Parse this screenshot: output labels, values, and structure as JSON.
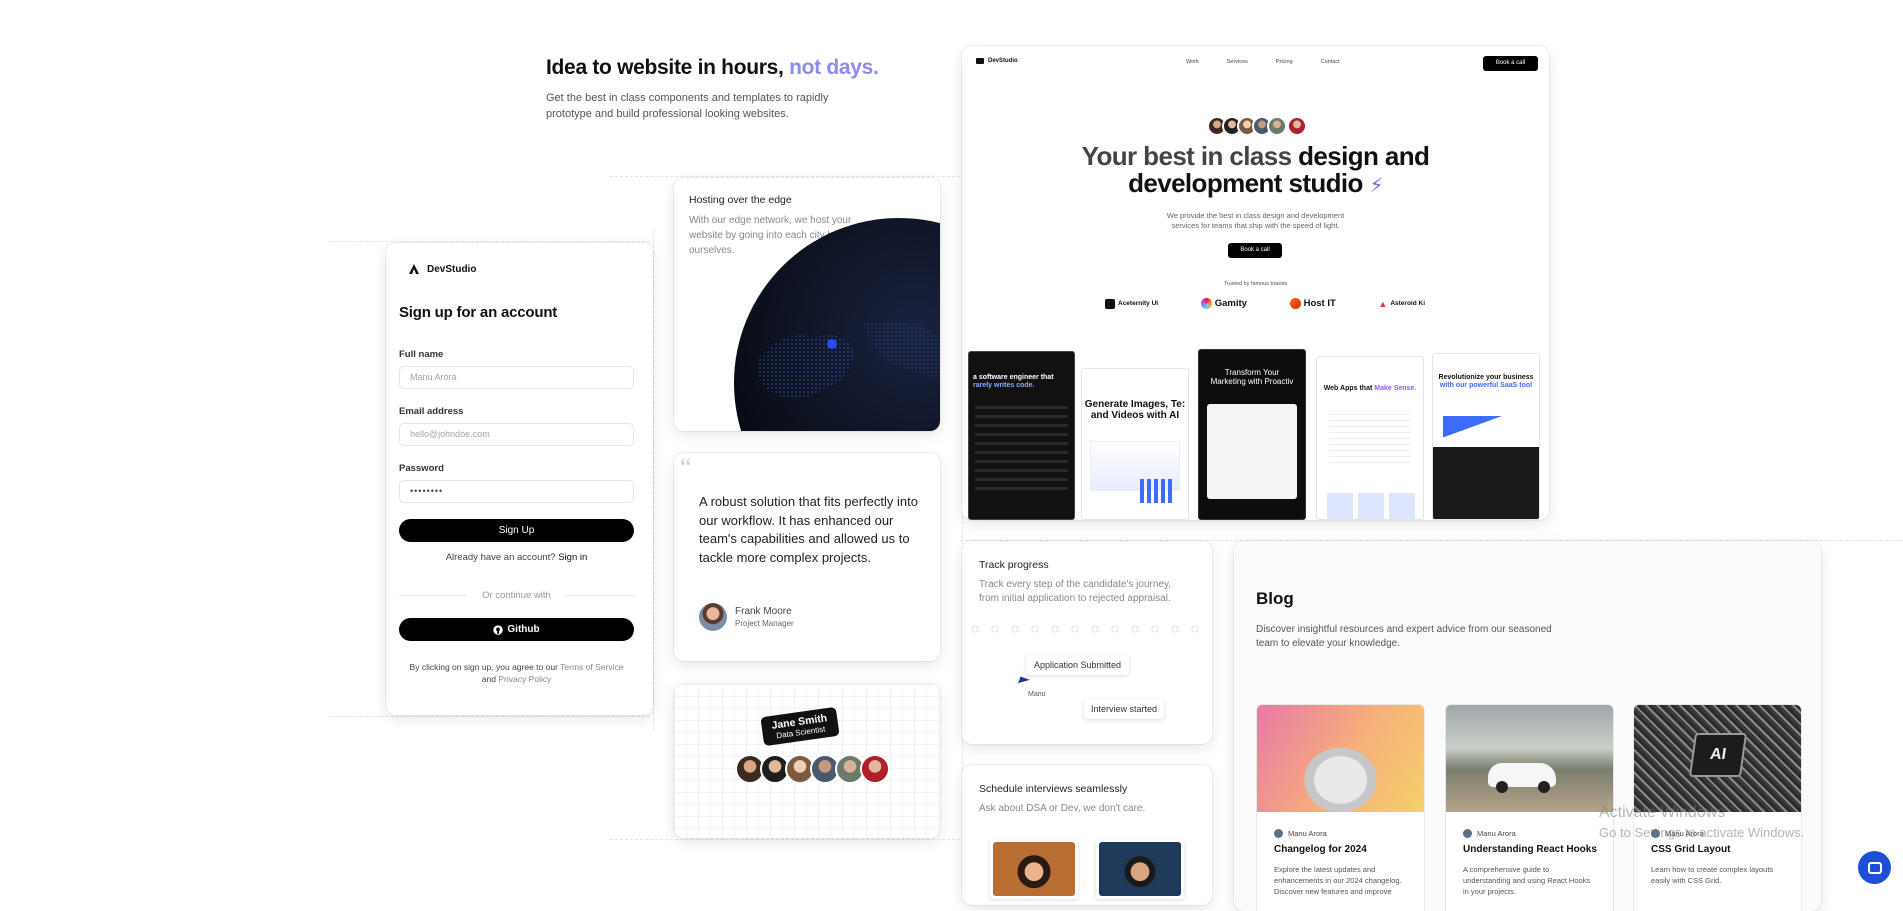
{
  "hero": {
    "title_main": "Idea to website in hours,",
    "title_accent": "not days.",
    "subtitle_l1": "Get the best in class components and templates to rapidly",
    "subtitle_l2": "prototype and build professional looking websites.",
    "accent_color": "#8b8cf0"
  },
  "signup": {
    "brand": "DevStudio",
    "title": "Sign up for an account",
    "fullname_label": "Full name",
    "fullname_placeholder": "Manu Arora",
    "email_label": "Email address",
    "email_placeholder": "hello@johndoe.com",
    "password_label": "Password",
    "password_placeholder": "••••••••",
    "submit": "Sign Up",
    "have_account": "Already have an account?",
    "signin": "Sign in",
    "divider": "Or continue with",
    "github": "Github",
    "terms_prefix": "By clicking on sign up, you agree to our",
    "terms_link": "Terms of Service",
    "and": "and",
    "privacy_link": "Privacy Policy"
  },
  "hosting": {
    "title": "Hosting over the edge",
    "desc_l1": "With our edge network, we host your",
    "desc_l2": "website by going into each city by",
    "desc_l3": "ourselves."
  },
  "testimonial": {
    "quote_mark": "“",
    "q1": "A robust solution that fits perfectly into",
    "q2": "our workflow. It has enhanced our",
    "q3": "team's capabilities and allowed us to",
    "q4": "tackle more complex projects.",
    "name": "Frank Moore",
    "role": "Project Manager"
  },
  "team": {
    "name": "Jane Smith",
    "role": "Data Scientist"
  },
  "preview": {
    "brand": "DevStudio",
    "nav": [
      "Work",
      "Services",
      "Pricing",
      "Contact"
    ],
    "cta": "Book a call",
    "h_light": "Your best in class",
    "h_dark": "design and",
    "h_line2": "development studio",
    "sub_l1": "We provide the best in class design and development",
    "sub_l2": "services for teams that ship with the speed of light.",
    "book": "Book a call",
    "trusted": "Trusted by famous brands",
    "brands": [
      "Aceternity UI",
      "Gamity",
      "Host IT",
      "Asteroid Ki"
    ],
    "thumbs": [
      {
        "l1": "a software engineer that",
        "l2": "rarely writes code."
      },
      {
        "l1": "Generate Images, Te:",
        "l2": "and Videos with AI"
      },
      {
        "l1": "Transform Your",
        "l2": "Marketing with Proactiv"
      },
      {
        "l1": "Web Apps that",
        "l2": "Make Sense."
      },
      {
        "l1": "Revolutionize your business",
        "l2": "with our powerful SaaS tool"
      }
    ]
  },
  "track": {
    "title": "Track progress",
    "desc_l1": "Track every step of the candidate's journey,",
    "desc_l2": "from initial application to rejected appraisal.",
    "chip1": "Application Submitted",
    "cursor_label": "Manu",
    "chip2": "Interview started"
  },
  "schedule": {
    "title": "Schedule interviews seamlessly",
    "desc": "Ask about DSA or Dev, we don't care."
  },
  "blog": {
    "title": "Blog",
    "desc_l1": "Discover insightful resources and expert advice from our seasoned",
    "desc_l2": "team to elevate your knowledge.",
    "posts": [
      {
        "author": "Manu Arora",
        "title": "Changelog for 2024",
        "ex1": "Explore the latest updates and",
        "ex2": "enhancements in our 2024 changelog.",
        "ex3": "Discover new features and improve"
      },
      {
        "author": "Manu Arora",
        "title": "Understanding React Hooks",
        "ex1": "A comprehensive guide to",
        "ex2": "understanding and using React Hooks",
        "ex3": "in your projects."
      },
      {
        "author": "Manu Arora",
        "title": "CSS Grid Layout",
        "ex1": "Learn how to create complex layouts",
        "ex2": "easily with CSS Grid.",
        "ex3": ""
      }
    ]
  },
  "watermark": {
    "l1": "Activate Windows",
    "l2": "Go to Settings to activate Windows."
  }
}
